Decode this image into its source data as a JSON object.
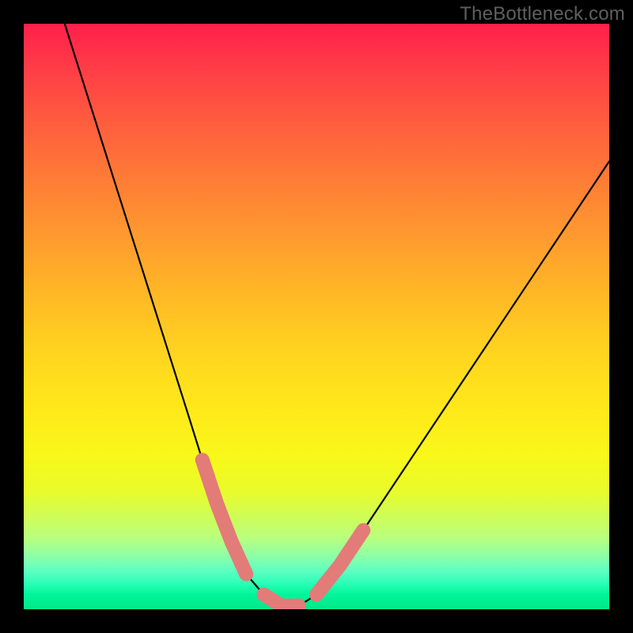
{
  "watermark": "TheBottleneck.com",
  "chart_data": {
    "type": "line",
    "title": "",
    "xlabel": "",
    "ylabel": "",
    "xlim": [
      0,
      1
    ],
    "ylim": [
      0,
      1
    ],
    "series": [
      {
        "name": "bottleneck-curve",
        "x": [
          0.07,
          0.1,
          0.13,
          0.16,
          0.19,
          0.22,
          0.25,
          0.28,
          0.305,
          0.33,
          0.355,
          0.38,
          0.41,
          0.44,
          0.47,
          0.5,
          0.54,
          0.58,
          0.62,
          0.66,
          0.7,
          0.74,
          0.78,
          0.82,
          0.86,
          0.9,
          0.94,
          0.98,
          1.0
        ],
        "y": [
          1.0,
          0.905,
          0.81,
          0.715,
          0.62,
          0.525,
          0.43,
          0.335,
          0.255,
          0.18,
          0.115,
          0.06,
          0.025,
          0.006,
          0.006,
          0.025,
          0.075,
          0.135,
          0.195,
          0.255,
          0.315,
          0.375,
          0.435,
          0.495,
          0.555,
          0.615,
          0.675,
          0.735,
          0.765
        ]
      }
    ],
    "markers": [
      {
        "name": "left-marker-segment",
        "color": "#e37b78",
        "x": [
          0.305,
          0.33,
          0.355,
          0.38
        ],
        "y": [
          0.255,
          0.18,
          0.115,
          0.06
        ]
      },
      {
        "name": "bottom-marker-segment",
        "color": "#e37b78",
        "x": [
          0.41,
          0.44,
          0.47
        ],
        "y": [
          0.025,
          0.006,
          0.006
        ]
      },
      {
        "name": "right-marker-segment",
        "color": "#e37b78",
        "x": [
          0.5,
          0.54,
          0.58
        ],
        "y": [
          0.025,
          0.075,
          0.135
        ]
      }
    ]
  }
}
